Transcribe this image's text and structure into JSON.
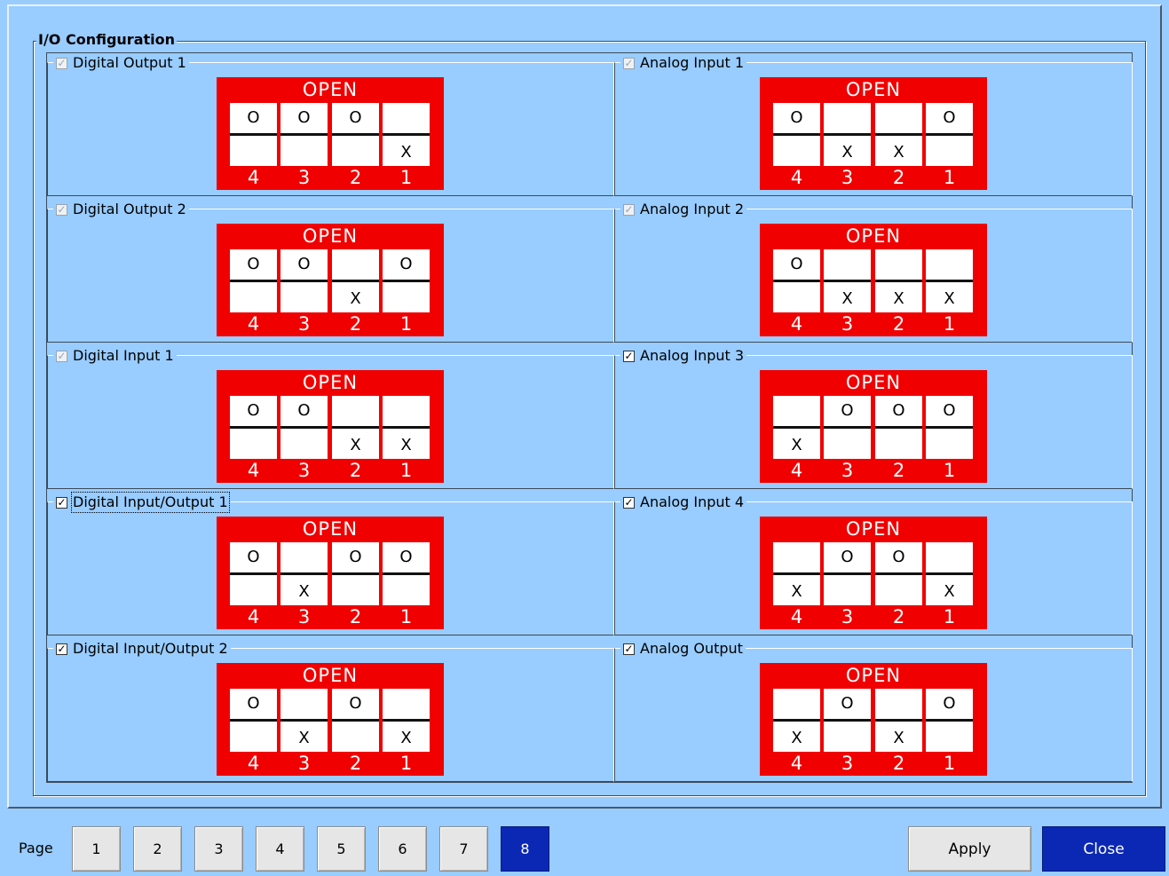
{
  "group_title": "I/O Configuration",
  "dip_open_label": "OPEN",
  "dip_numbers": [
    "4",
    "3",
    "2",
    "1"
  ],
  "panels": [
    {
      "label": "Digital Output 1",
      "checked": true,
      "enabled": false,
      "focused": false,
      "switches": [
        "O",
        "O",
        "O",
        "X"
      ]
    },
    {
      "label": "Analog Input 1",
      "checked": true,
      "enabled": false,
      "focused": false,
      "switches": [
        "O",
        "X",
        "X",
        "O"
      ]
    },
    {
      "label": "Digital Output 2",
      "checked": true,
      "enabled": false,
      "focused": false,
      "switches": [
        "O",
        "O",
        "X",
        "O"
      ]
    },
    {
      "label": "Analog Input 2",
      "checked": true,
      "enabled": false,
      "focused": false,
      "switches": [
        "O",
        "X",
        "X",
        "X"
      ]
    },
    {
      "label": "Digital Input 1",
      "checked": true,
      "enabled": false,
      "focused": false,
      "switches": [
        "O",
        "O",
        "X",
        "X"
      ]
    },
    {
      "label": "Analog Input 3",
      "checked": true,
      "enabled": true,
      "focused": false,
      "switches": [
        "X",
        "O",
        "O",
        "O"
      ]
    },
    {
      "label": "Digital Input/Output 1",
      "checked": true,
      "enabled": true,
      "focused": true,
      "switches": [
        "O",
        "X",
        "O",
        "O"
      ]
    },
    {
      "label": "Analog Input 4",
      "checked": true,
      "enabled": true,
      "focused": false,
      "switches": [
        "X",
        "O",
        "O",
        "X"
      ]
    },
    {
      "label": "Digital Input/Output 2",
      "checked": true,
      "enabled": true,
      "focused": false,
      "switches": [
        "O",
        "X",
        "O",
        "X"
      ]
    },
    {
      "label": "Analog Output",
      "checked": true,
      "enabled": true,
      "focused": false,
      "switches": [
        "X",
        "O",
        "X",
        "O"
      ]
    }
  ],
  "footer": {
    "page_label": "Page",
    "pages": [
      "1",
      "2",
      "3",
      "4",
      "5",
      "6",
      "7",
      "8"
    ],
    "active_page": "8",
    "apply_label": "Apply",
    "close_label": "Close"
  },
  "colors": {
    "background": "#99ccff",
    "dip_red": "#f00000",
    "accent_blue": "#0a28b4"
  }
}
